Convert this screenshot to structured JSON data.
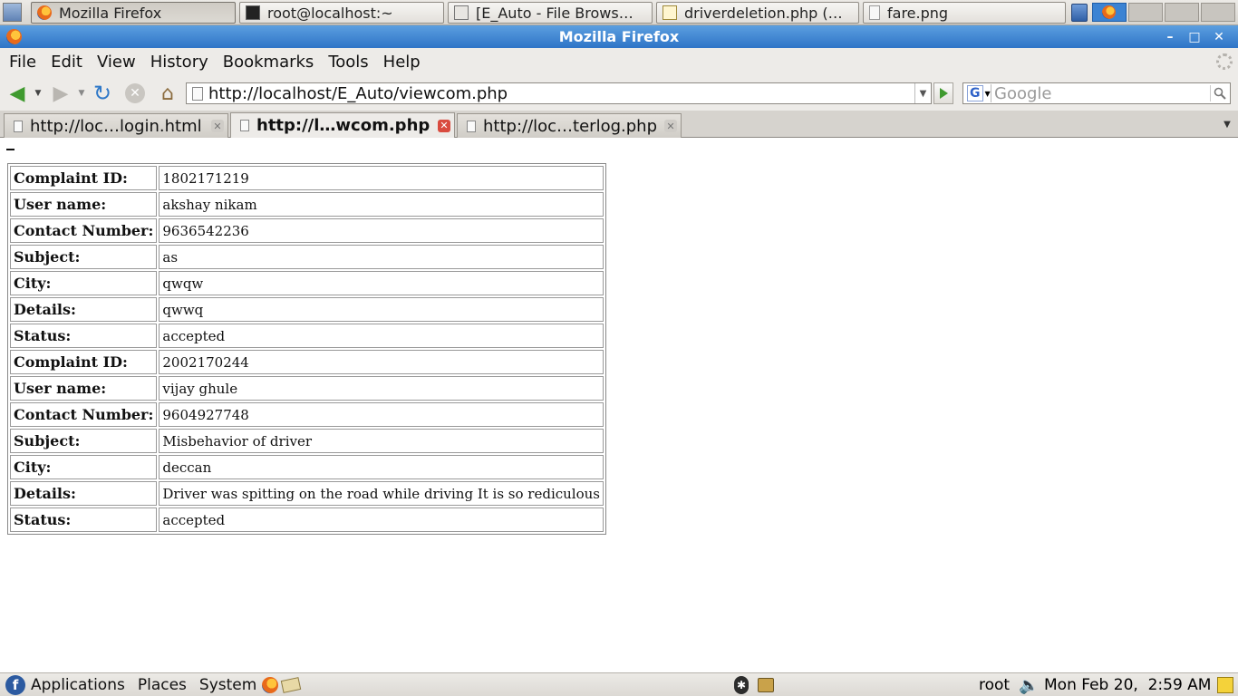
{
  "taskbar": {
    "windows": [
      {
        "label": "Mozilla Firefox",
        "icon": "firefox-icon",
        "active": true
      },
      {
        "label": "root@localhost:~",
        "icon": "terminal-icon",
        "active": false
      },
      {
        "label": "[E_Auto - File Brows…",
        "icon": "file-browser-icon",
        "active": false
      },
      {
        "label": "driverdeletion.php (…",
        "icon": "text-editor-icon",
        "active": false
      },
      {
        "label": "fare.png",
        "icon": "image-file-icon",
        "active": false
      }
    ]
  },
  "window": {
    "title": "Mozilla Firefox",
    "minimize": "–",
    "maximize": "□",
    "close": "✕"
  },
  "menubar": {
    "items": [
      "File",
      "Edit",
      "View",
      "History",
      "Bookmarks",
      "Tools",
      "Help"
    ]
  },
  "navbar": {
    "url": "http://localhost/E_Auto/viewcom.php",
    "search_placeholder": "Google",
    "search_engine": "G"
  },
  "tabs": [
    {
      "label": "http://loc…login.html",
      "selected": false
    },
    {
      "label": "http://l…wcom.php",
      "selected": true
    },
    {
      "label": "http://loc…terlog.php",
      "selected": false
    }
  ],
  "complaints": {
    "rows": [
      {
        "label": "Complaint ID:",
        "value": "1802171219"
      },
      {
        "label": "User name:",
        "value": "akshay nikam"
      },
      {
        "label": "Contact Number:",
        "value": "9636542236"
      },
      {
        "label": "Subject:",
        "value": "as"
      },
      {
        "label": "City:",
        "value": "qwqw"
      },
      {
        "label": "Details:",
        "value": "qwwq"
      },
      {
        "label": "Status:",
        "value": "accepted"
      },
      {
        "label": "Complaint ID:",
        "value": "2002170244"
      },
      {
        "label": "User name:",
        "value": "vijay ghule"
      },
      {
        "label": "Contact Number:",
        "value": "9604927748"
      },
      {
        "label": "Subject:",
        "value": "Misbehavior of driver"
      },
      {
        "label": "City:",
        "value": "deccan"
      },
      {
        "label": "Details:",
        "value": "Driver was spitting on the road while driving It is so rediculous"
      },
      {
        "label": "Status:",
        "value": "accepted"
      }
    ]
  },
  "bottom_panel": {
    "menus": [
      "Applications",
      "Places",
      "System"
    ],
    "user": "root",
    "clock": "Mon Feb 20,  2:59 AM"
  },
  "colors": {
    "titlebar": "#2e74c7",
    "panel": "#dcd9d4",
    "selected_tab_close": "#d94b3f"
  }
}
